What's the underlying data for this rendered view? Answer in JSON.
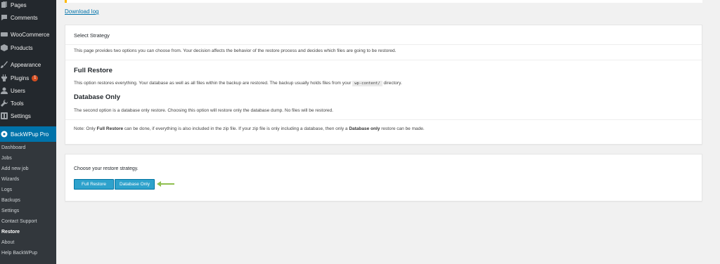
{
  "sidebar": {
    "items": [
      {
        "label": "Pages",
        "icon": "pages-icon"
      },
      {
        "label": "Comments",
        "icon": "comments-icon"
      },
      {
        "label": "WooCommerce",
        "icon": "woocommerce-icon"
      },
      {
        "label": "Products",
        "icon": "products-icon"
      },
      {
        "label": "Appearance",
        "icon": "appearance-icon"
      },
      {
        "label": "Plugins",
        "icon": "plugins-icon",
        "badge": "1"
      },
      {
        "label": "Users",
        "icon": "users-icon"
      },
      {
        "label": "Tools",
        "icon": "tools-icon"
      },
      {
        "label": "Settings",
        "icon": "settings-icon"
      },
      {
        "label": "BackWPup Pro",
        "icon": "backwpup-icon"
      }
    ],
    "submenu": [
      "Dashboard",
      "Jobs",
      "Add new job",
      "Wizards",
      "Logs",
      "Backups",
      "Settings",
      "Contact Support",
      "Restore",
      "About",
      "Help BackWPup"
    ],
    "current_submenu": "Restore"
  },
  "main": {
    "download_log": "Download log",
    "strategy": {
      "title": "Select Strategy",
      "intro": "This page provides two options you can choose from. Your decision affects the behavior of the restore process and decides which files are going to be restored.",
      "full_title": "Full Restore",
      "full_desc_before": "This option restores everything. Your database as well as all files within the backup are restored. The backup usually holds files from your",
      "full_desc_code": "wp-content/",
      "full_desc_after": "directory.",
      "db_title": "Database Only",
      "db_desc": "The second option is a database only restore. Choosing this option will restore only the database dump. No files will be restored.",
      "note_1": "Note: Only",
      "note_bold1": "Full Restore",
      "note_2": "can be done, if everything is also included in the zip file. If your zip file is only including a database, then only a",
      "note_bold2": "Database only",
      "note_3": "restore can be made."
    },
    "choose": {
      "label": "Choose your restore strategy.",
      "full_button": "Full Restore",
      "db_button": "Database Only"
    }
  },
  "colors": {
    "sidebar_bg": "#23282d",
    "submenu_bg": "#32373c",
    "active": "#0073aa",
    "button": "#2ea2cc",
    "arrow": "#8fbf4f",
    "badge": "#d54e21"
  }
}
